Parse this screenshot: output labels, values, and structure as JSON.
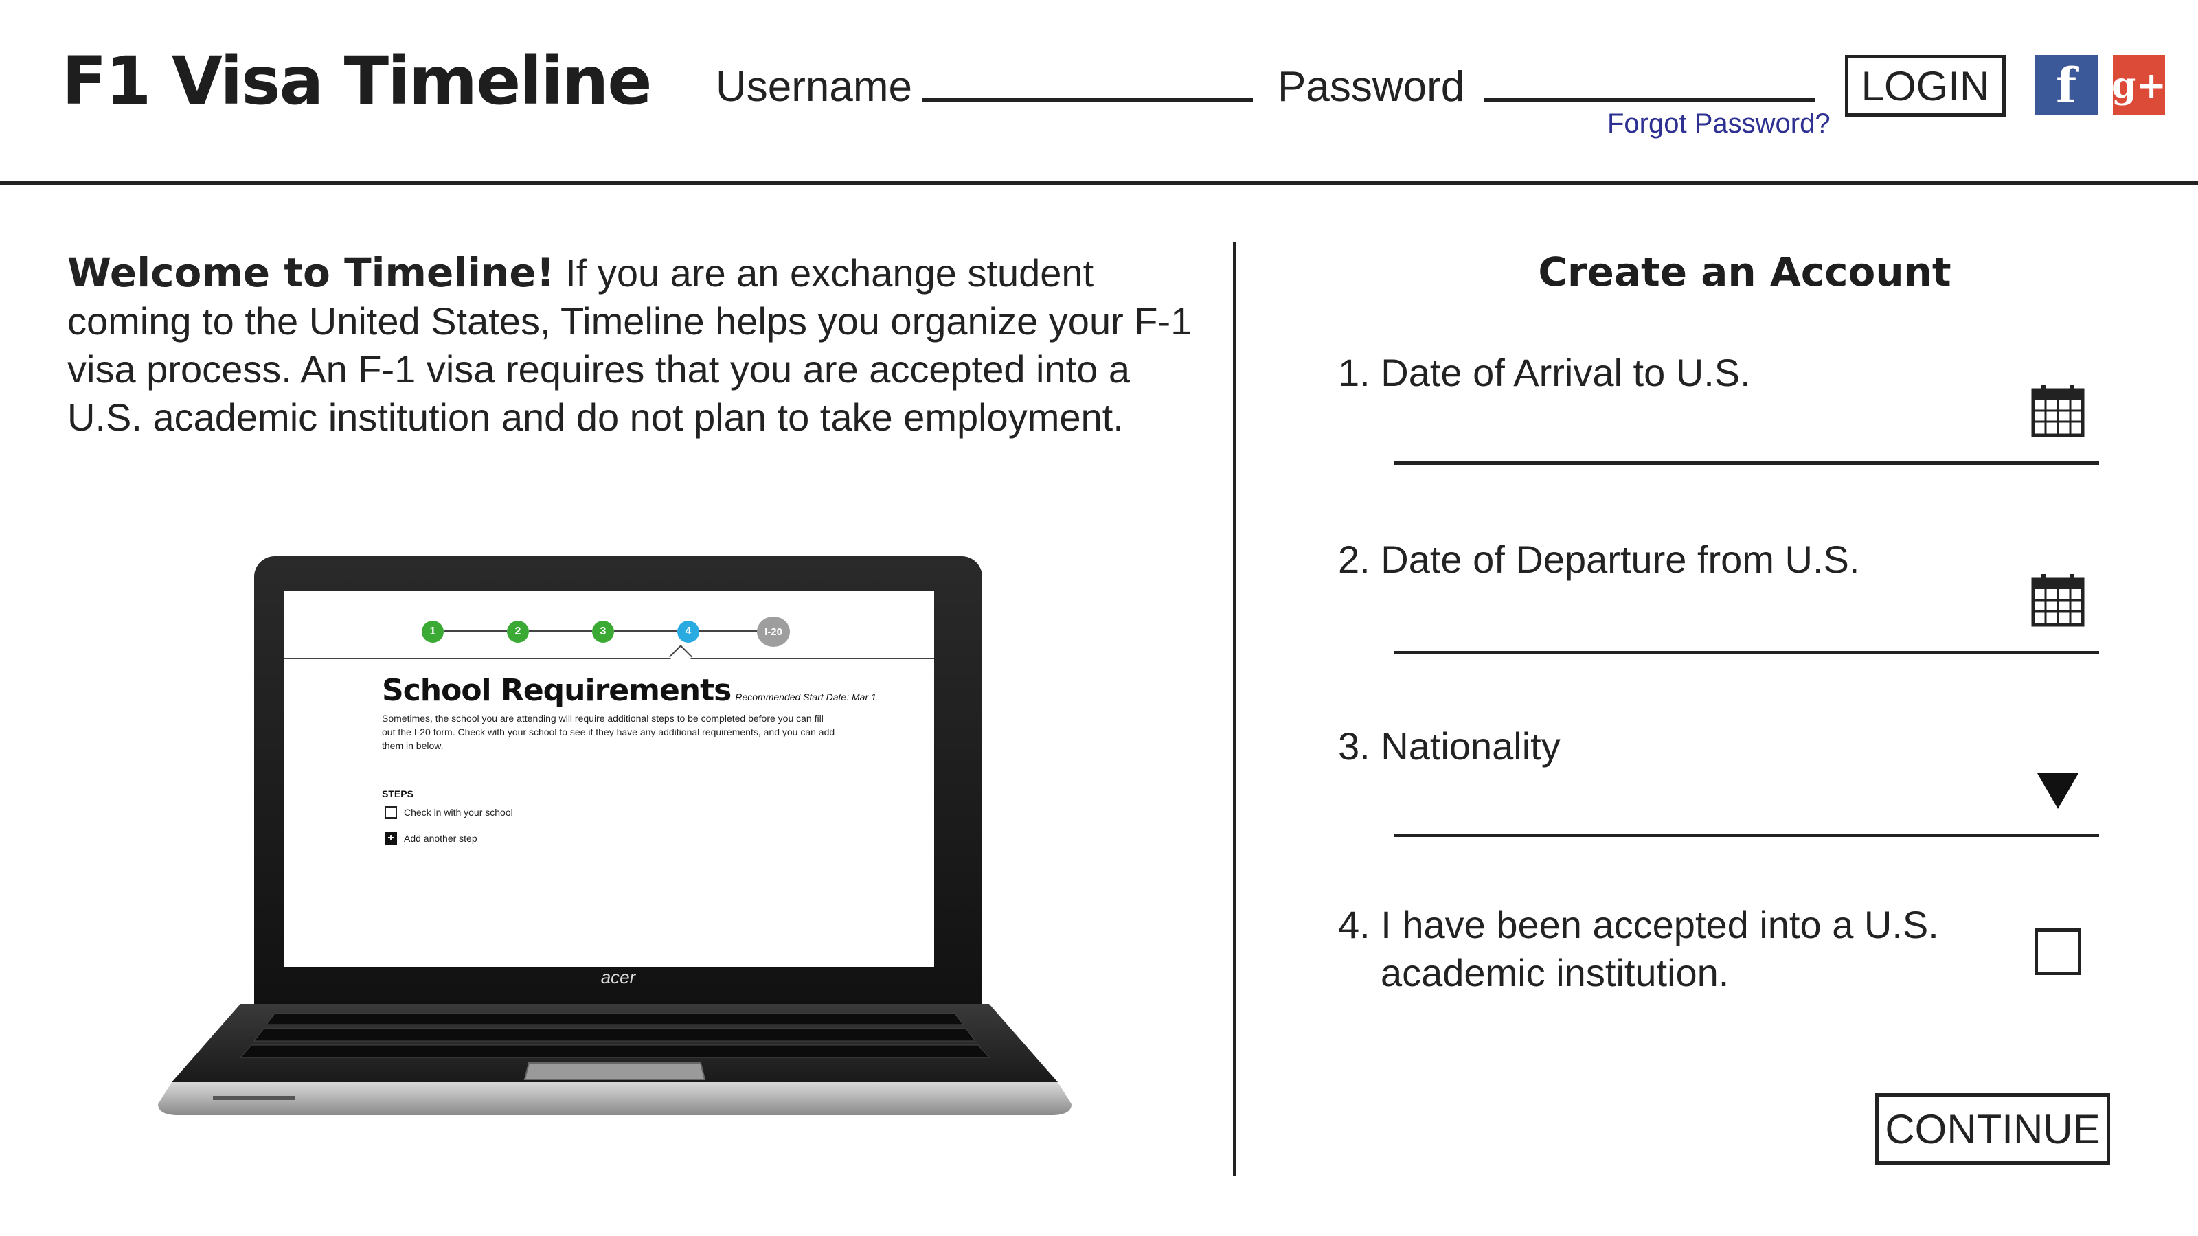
{
  "header": {
    "title": "F1 Visa Timeline",
    "username_label": "Username",
    "username_value": "",
    "password_label": "Password",
    "password_value": "",
    "forgot_password": "Forgot Password?",
    "login_label": "LOGIN",
    "social": {
      "facebook": {
        "glyph": "f",
        "color": "#3b5998",
        "icon": "facebook-icon"
      },
      "google_plus": {
        "glyph": "g+",
        "color": "#dc4a38",
        "icon": "google-plus-icon"
      }
    }
  },
  "welcome": {
    "heading": "Welcome to Timeline!",
    "body": "If you are an exchange student coming to the United States, Timeline helps you organize your F-1 visa process. An F-1 visa requires that you are accepted into a U.S. academic institution and do not plan to take employment."
  },
  "laptop_preview": {
    "brand": "acer",
    "progress_steps": [
      {
        "label": "1",
        "color": "#3aaa35"
      },
      {
        "label": "2",
        "color": "#3aaa35"
      },
      {
        "label": "3",
        "color": "#3aaa35"
      },
      {
        "label": "4",
        "color": "#29abe2"
      },
      {
        "label": "I-20",
        "color": "#9e9e9e"
      }
    ],
    "heading": "School Requirements",
    "start_date": "Recommended Start Date: Mar 1",
    "description": "Sometimes, the school you are attending will require additional steps to be completed before you can fill out the I-20 form. Check with your school to see if they have any additional requirements, and you can add them in below.",
    "steps_label": "STEPS",
    "step_item": "Check in with your school",
    "add_step": "Add another step"
  },
  "form": {
    "title": "Create an Account",
    "fields": [
      {
        "label": "1.  Date of Arrival to U.S.",
        "value": "",
        "icon": "calendar-icon"
      },
      {
        "label": "2.  Date of Departure from U.S.",
        "value": "",
        "icon": "calendar-icon"
      },
      {
        "label": "3.  Nationality",
        "value": "",
        "icon": "dropdown-arrow-icon"
      }
    ],
    "acceptance_label_line1": "4.  I have been accepted into a U.S.",
    "acceptance_label_line2": "academic institution.",
    "acceptance_checked": false,
    "continue_label": "CONTINUE"
  }
}
